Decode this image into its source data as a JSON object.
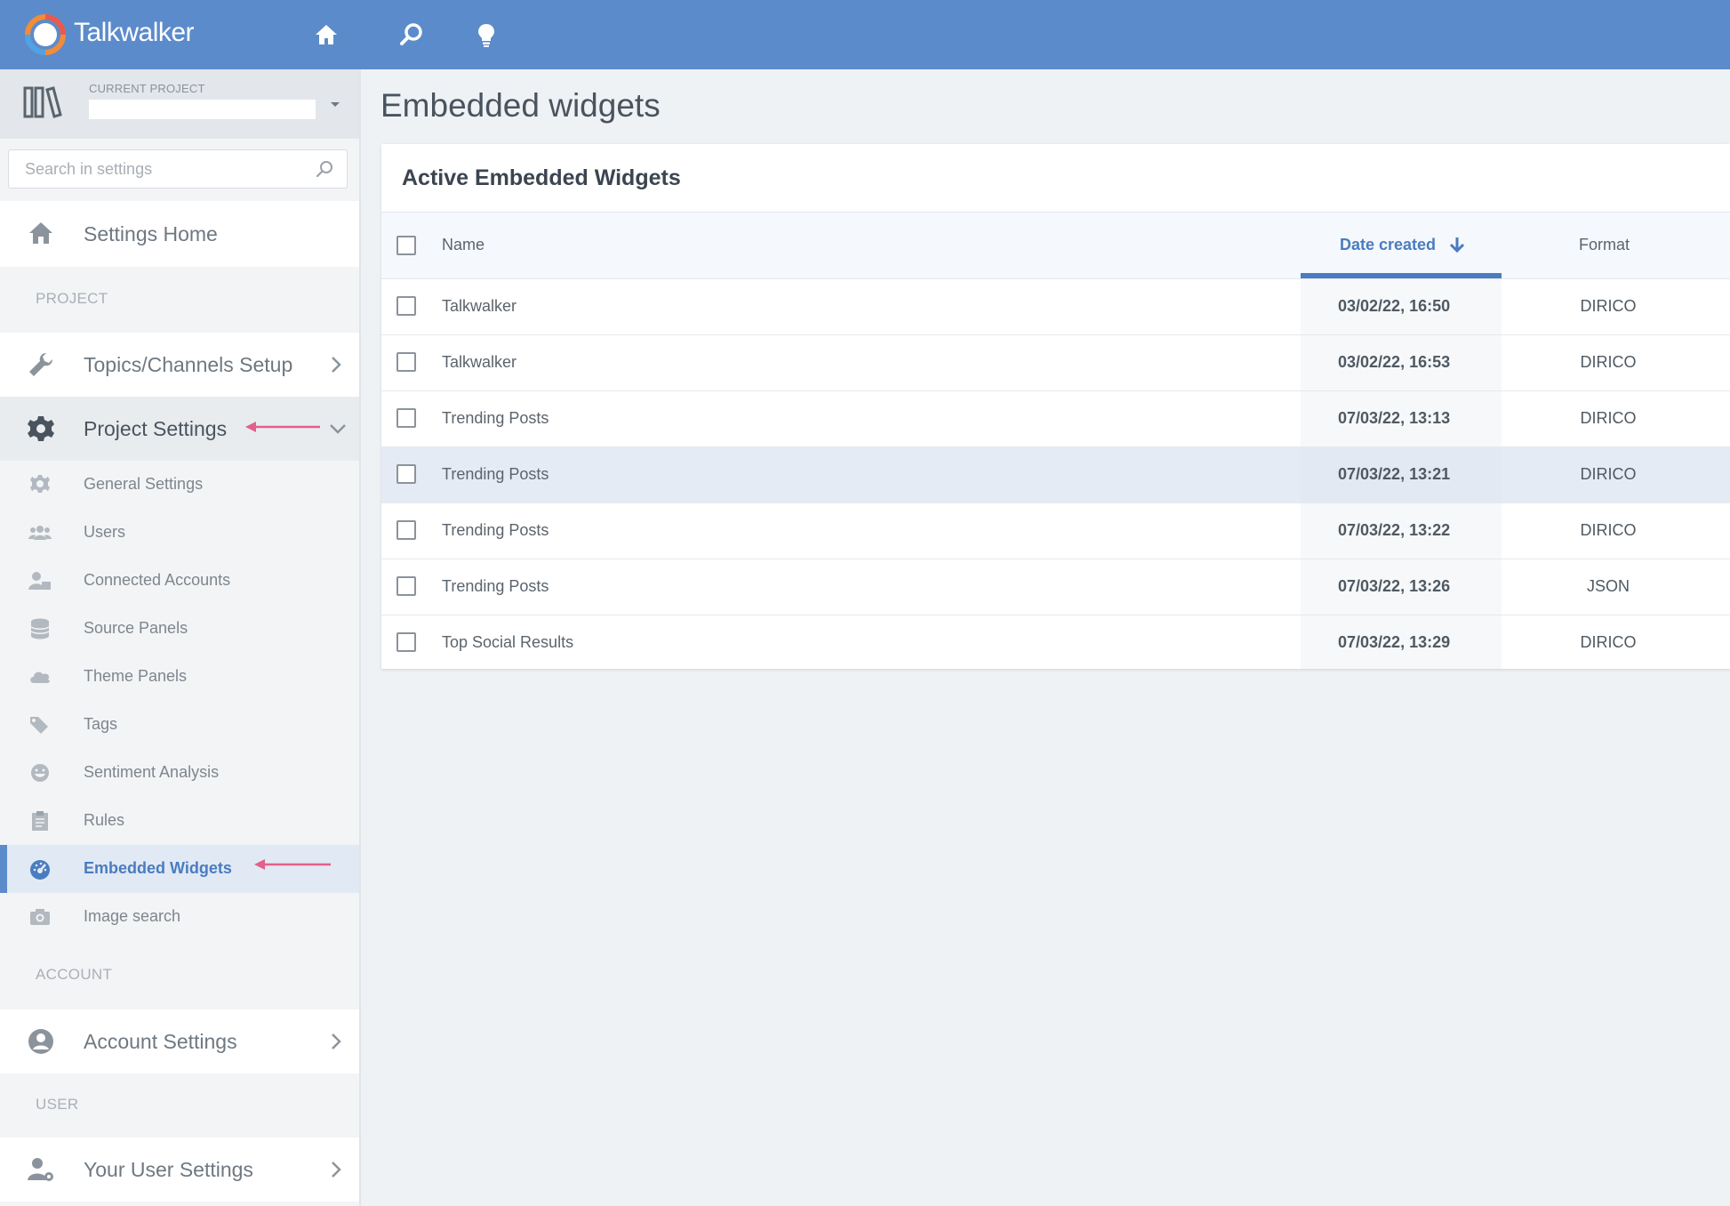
{
  "app": {
    "brand": "Talkwalker"
  },
  "colors": {
    "topbar": "#5b8bcb",
    "accent": "#4a7cc0",
    "annotation_arrow": "#e2608a"
  },
  "topnav": {
    "icons": [
      "home-icon",
      "search-icon",
      "lightbulb-icon"
    ]
  },
  "project": {
    "caption": "CURRENT PROJECT",
    "name": ""
  },
  "search": {
    "placeholder": "Search in settings"
  },
  "sidebar": {
    "settings_home": "Settings Home",
    "section_project": "PROJECT",
    "topics_setup": "Topics/Channels Setup",
    "project_settings": "Project Settings",
    "items": [
      {
        "label": "General Settings",
        "icon": "gear-icon"
      },
      {
        "label": "Users",
        "icon": "users-icon"
      },
      {
        "label": "Connected Accounts",
        "icon": "connected-accounts-icon"
      },
      {
        "label": "Source Panels",
        "icon": "database-icon"
      },
      {
        "label": "Theme Panels",
        "icon": "cloud-icon"
      },
      {
        "label": "Tags",
        "icon": "tags-icon"
      },
      {
        "label": "Sentiment Analysis",
        "icon": "smiley-icon"
      },
      {
        "label": "Rules",
        "icon": "clipboard-icon"
      },
      {
        "label": "Embedded Widgets",
        "icon": "dashboard-icon",
        "active": true
      },
      {
        "label": "Image search",
        "icon": "camera-icon"
      }
    ],
    "section_account": "ACCOUNT",
    "account_settings": "Account Settings",
    "section_user": "USER",
    "user_settings": "Your User Settings"
  },
  "main": {
    "page_title": "Embedded widgets",
    "card_title": "Active Embedded Widgets",
    "columns": {
      "name": "Name",
      "date": "Date created",
      "format": "Format"
    },
    "rows": [
      {
        "name": "Talkwalker",
        "date": "03/02/22, 16:50",
        "format": "DIRICO"
      },
      {
        "name": "Talkwalker",
        "date": "03/02/22, 16:53",
        "format": "DIRICO"
      },
      {
        "name": "Trending Posts",
        "date": "07/03/22, 13:13",
        "format": "DIRICO"
      },
      {
        "name": "Trending Posts",
        "date": "07/03/22, 13:21",
        "format": "DIRICO"
      },
      {
        "name": "Trending Posts",
        "date": "07/03/22, 13:22",
        "format": "DIRICO"
      },
      {
        "name": "Trending Posts",
        "date": "07/03/22, 13:26",
        "format": "JSON"
      },
      {
        "name": "Top Social Results",
        "date": "07/03/22, 13:29",
        "format": "DIRICO"
      }
    ]
  }
}
